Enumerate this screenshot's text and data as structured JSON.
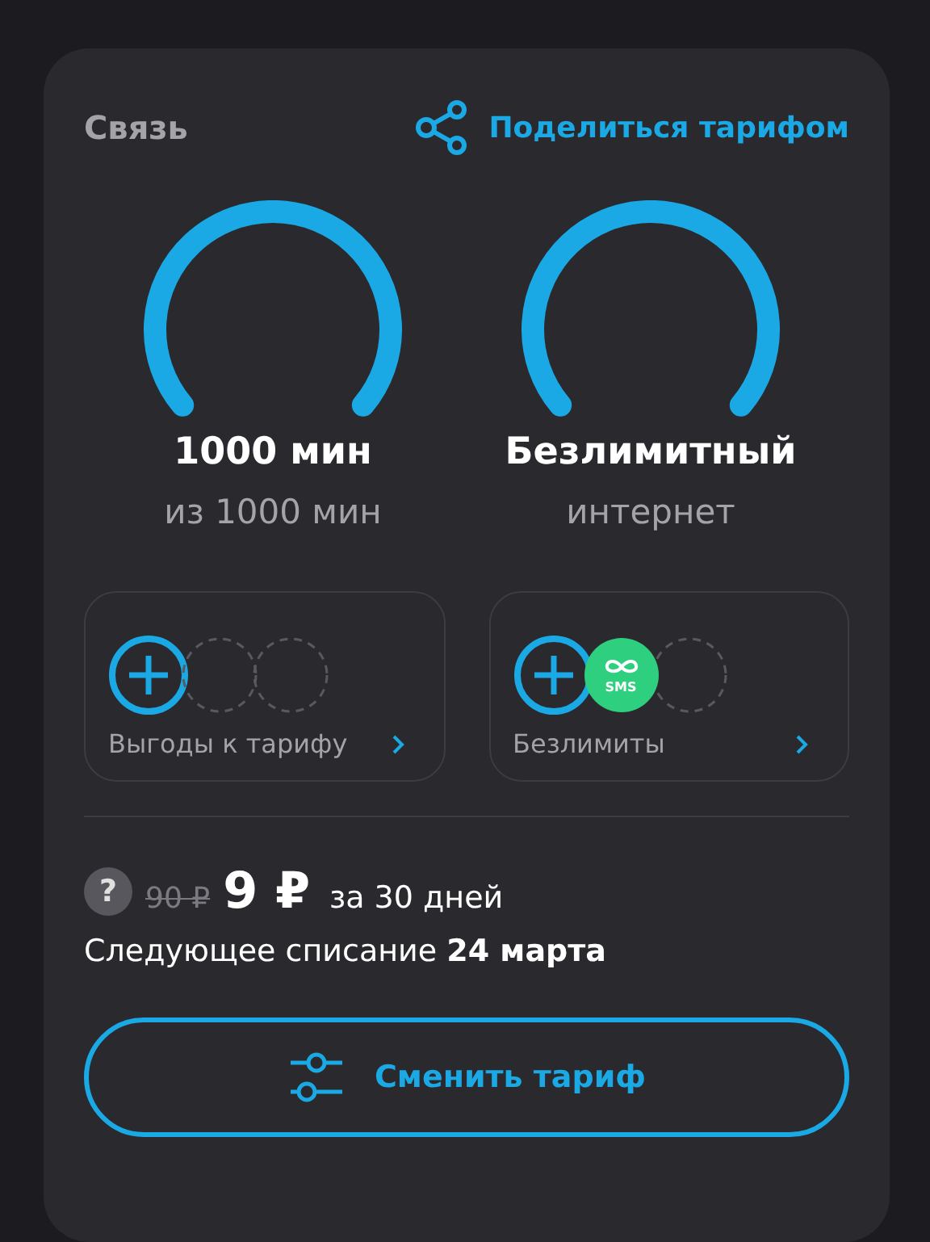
{
  "header": {
    "title": "Связь",
    "share_link": "Поделиться тарифом"
  },
  "gauges": [
    {
      "value": "1000 мин",
      "caption": "из 1000 мин"
    },
    {
      "value": "Безлимитный",
      "caption": "интернет"
    }
  ],
  "tiles": [
    {
      "label": "Выгоды к тарифу",
      "slots": [
        {
          "kind": "add"
        },
        {
          "kind": "empty"
        },
        {
          "kind": "empty"
        }
      ]
    },
    {
      "label": "Безлимиты",
      "slots": [
        {
          "kind": "add"
        },
        {
          "kind": "sms",
          "text": "SMS"
        },
        {
          "kind": "empty"
        }
      ]
    }
  ],
  "price": {
    "help": "?",
    "old": "90 ₽",
    "new": "9 ₽",
    "period": "за 30 дней"
  },
  "next_charge": "Следующее списание **24 марта**",
  "button": "Сменить тариф"
}
